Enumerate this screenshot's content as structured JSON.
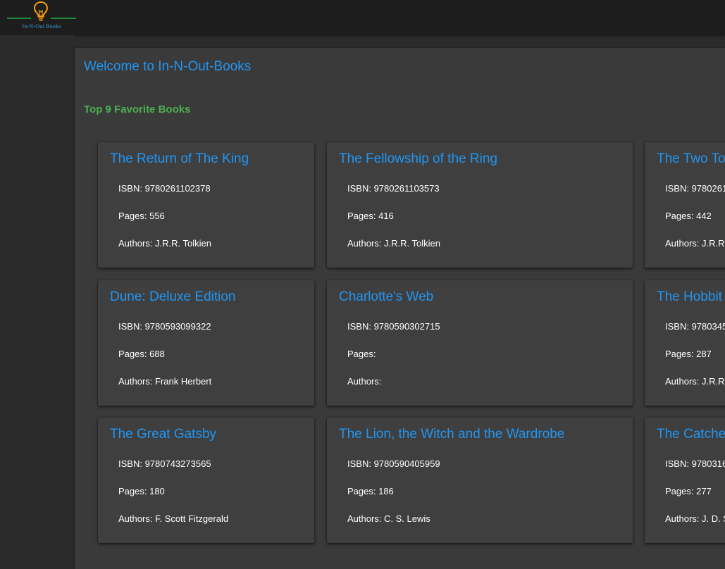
{
  "header": {
    "logo_text": "In-N-Out Books",
    "colors": {
      "bulb": "#f39c12",
      "line": "#1f8a3d",
      "text": "#3a9bdc"
    }
  },
  "main": {
    "welcome": "Welcome to In-N-Out-Books",
    "section_title": "Top 9 Favorite Books",
    "colors": {
      "title": "#2196f3",
      "section": "#4caf50",
      "card_bg": "#3f3f3f"
    }
  },
  "books": [
    {
      "title": "The Return of The King",
      "isbn": "ISBN: 9780261102378",
      "pages": "Pages: 556",
      "authors": "Authors: J.R.R. Tolkien"
    },
    {
      "title": "The Fellowship of the Ring",
      "isbn": "ISBN: 9780261103573",
      "pages": "Pages: 416",
      "authors": "Authors: J.R.R. Tolkien"
    },
    {
      "title": "The Two To",
      "isbn": "ISBN: 9780261",
      "pages": "Pages: 442",
      "authors": "Authors: J.R.R."
    },
    {
      "title": "Dune: Deluxe Edition",
      "isbn": "ISBN: 9780593099322",
      "pages": "Pages: 688",
      "authors": "Authors: Frank Herbert"
    },
    {
      "title": "Charlotte's Web",
      "isbn": "ISBN: 9780590302715",
      "pages": "Pages:",
      "authors": "Authors:"
    },
    {
      "title": "The Hobbit",
      "isbn": "ISBN: 9780345",
      "pages": "Pages: 287",
      "authors": "Authors: J.R.R."
    },
    {
      "title": "The Great Gatsby",
      "isbn": "ISBN: 9780743273565",
      "pages": "Pages: 180",
      "authors": "Authors: F. Scott Fitzgerald"
    },
    {
      "title": "The Lion, the Witch and the Wardrobe",
      "isbn": "ISBN: 9780590405959",
      "pages": "Pages: 186",
      "authors": "Authors: C. S. Lewis"
    },
    {
      "title": "The Catche",
      "isbn": "ISBN: 9780316",
      "pages": "Pages: 277",
      "authors": "Authors: J. D. S"
    }
  ]
}
